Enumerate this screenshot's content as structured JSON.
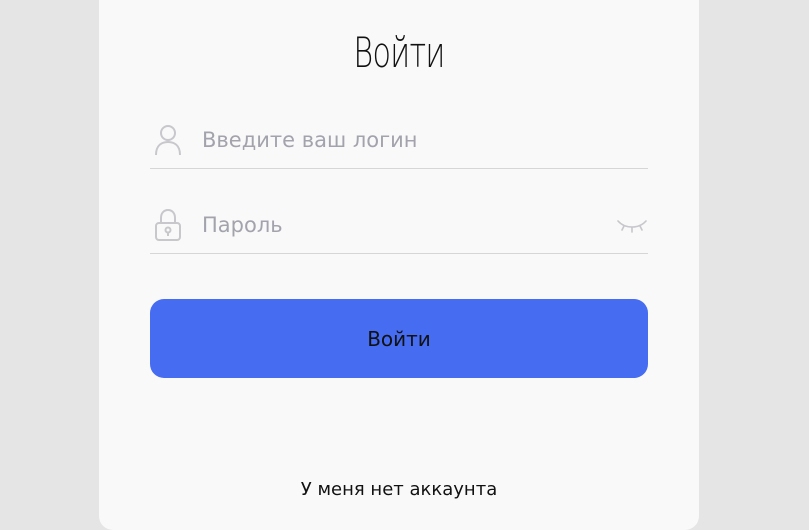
{
  "form": {
    "title": "Войти",
    "login": {
      "value": "",
      "placeholder": "Введите ваш логин",
      "icon": "user-icon"
    },
    "password": {
      "value": "",
      "placeholder": "Пароль",
      "icon": "lock-icon",
      "toggle_icon": "eye-closed-icon"
    },
    "submit_label": "Войти",
    "no_account_label": "У меня нет аккаунта"
  },
  "colors": {
    "page_background": "#e5e5e5",
    "card_background": "#f9f9f9",
    "button": "#466cf2",
    "placeholder": "#a3a3ad",
    "divider": "#d6d6d6"
  }
}
